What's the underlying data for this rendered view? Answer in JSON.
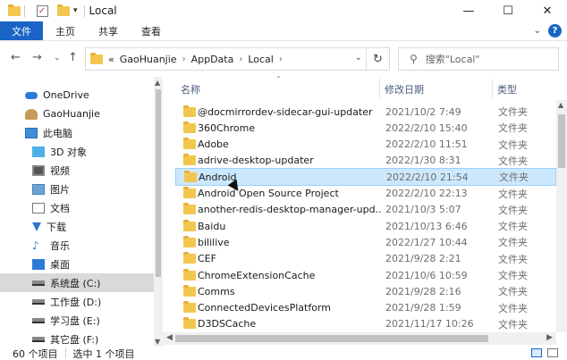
{
  "window": {
    "title": "Local",
    "controls": [
      "—",
      "☐",
      "✕"
    ]
  },
  "ribbon": {
    "tabs": [
      "文件",
      "主页",
      "共享",
      "查看"
    ],
    "help": "?"
  },
  "address": {
    "prefix": "«",
    "path": [
      "GaoHuanjie",
      "AppData",
      "Local"
    ],
    "search_placeholder": "搜索\"Local\""
  },
  "nav_pane": {
    "items": [
      {
        "label": "OneDrive",
        "icon": "cloud-icon"
      },
      {
        "label": "GaoHuanjie",
        "icon": "user-icon"
      },
      {
        "label": "此电脑",
        "icon": "pc-icon"
      },
      {
        "label": "3D 对象",
        "icon": "cube-icon"
      },
      {
        "label": "视频",
        "icon": "video-icon"
      },
      {
        "label": "图片",
        "icon": "picture-icon"
      },
      {
        "label": "文档",
        "icon": "document-icon"
      },
      {
        "label": "下载",
        "icon": "download-icon"
      },
      {
        "label": "音乐",
        "icon": "music-icon"
      },
      {
        "label": "桌面",
        "icon": "desktop-icon"
      },
      {
        "label": "系统盘 (C:)",
        "icon": "drive-icon",
        "selected": true
      },
      {
        "label": "工作盘 (D:)",
        "icon": "drive-icon"
      },
      {
        "label": "学习盘 (E:)",
        "icon": "drive-icon"
      },
      {
        "label": "其它盘 (F:)",
        "icon": "drive-icon"
      }
    ]
  },
  "columns": {
    "name": "名称",
    "date": "修改日期",
    "type": "类型"
  },
  "files": [
    {
      "name": "@docmirrordev-sidecar-gui-updater",
      "date": "2021/10/2 7:49",
      "type": "文件夹"
    },
    {
      "name": "360Chrome",
      "date": "2022/2/10 15:40",
      "type": "文件夹"
    },
    {
      "name": "Adobe",
      "date": "2022/2/10 11:51",
      "type": "文件夹"
    },
    {
      "name": "adrive-desktop-updater",
      "date": "2022/1/30 8:31",
      "type": "文件夹"
    },
    {
      "name": "Android",
      "date": "2022/2/10 21:54",
      "type": "文件夹",
      "selected": true
    },
    {
      "name": "Android Open Source Project",
      "date": "2022/2/10 22:13",
      "type": "文件夹"
    },
    {
      "name": "another-redis-desktop-manager-upd...",
      "date": "2021/10/3 5:07",
      "type": "文件夹"
    },
    {
      "name": "Baidu",
      "date": "2021/10/13 6:46",
      "type": "文件夹"
    },
    {
      "name": "bililive",
      "date": "2022/1/27 10:44",
      "type": "文件夹"
    },
    {
      "name": "CEF",
      "date": "2021/9/28 2:21",
      "type": "文件夹"
    },
    {
      "name": "ChromeExtensionCache",
      "date": "2021/10/6 10:59",
      "type": "文件夹"
    },
    {
      "name": "Comms",
      "date": "2021/9/28 2:16",
      "type": "文件夹"
    },
    {
      "name": "ConnectedDevicesPlatform",
      "date": "2021/9/28 1:59",
      "type": "文件夹"
    },
    {
      "name": "D3DSCache",
      "date": "2021/11/17 10:26",
      "type": "文件夹"
    }
  ],
  "status": {
    "count": "60 个项目",
    "selection": "选中 1 个项目"
  }
}
